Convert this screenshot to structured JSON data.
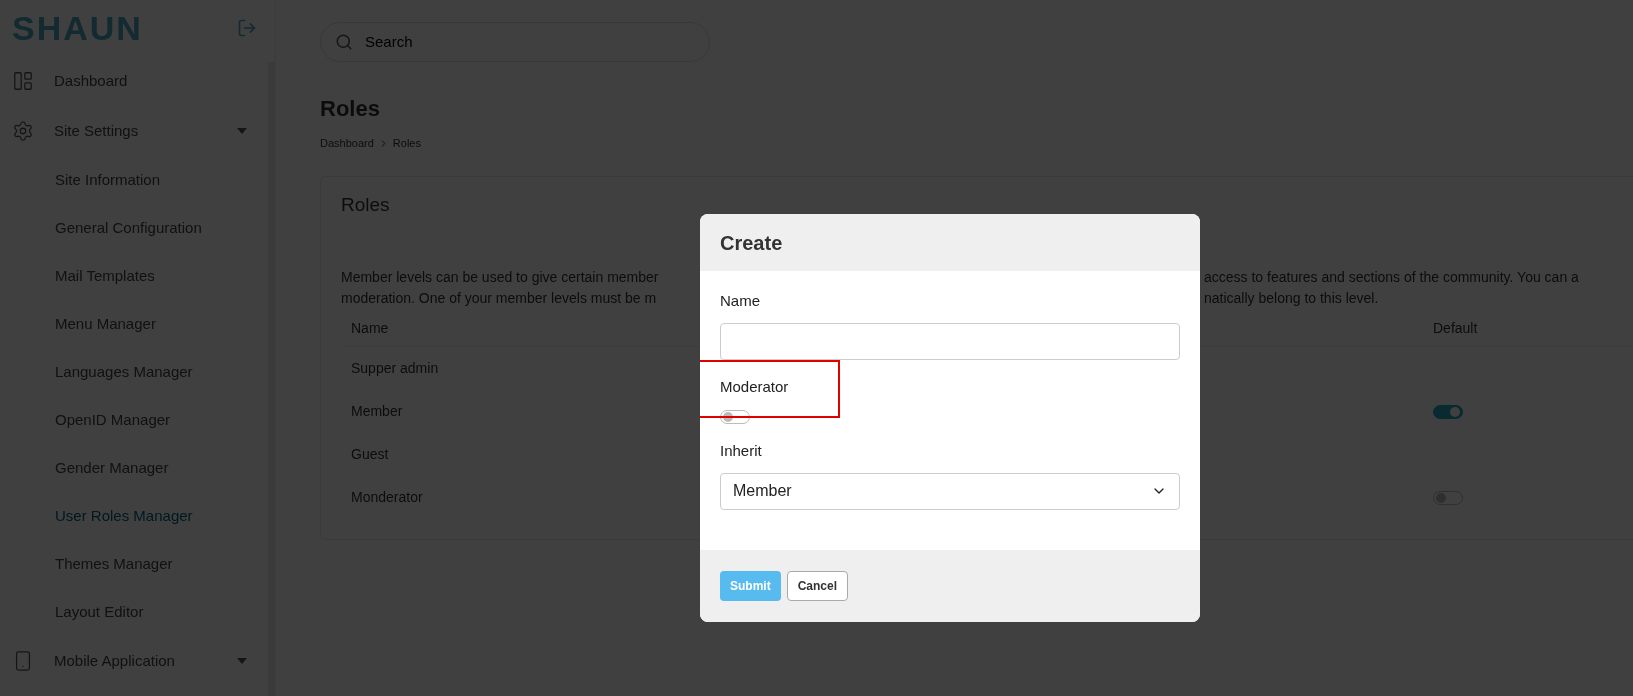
{
  "sidebar": {
    "logo": "SHAUN",
    "items": [
      {
        "kind": "link",
        "label": "Dashboard",
        "selected": false
      },
      {
        "kind": "group",
        "label": "Site Settings",
        "children": [
          {
            "label": "Site Information",
            "selected": false
          },
          {
            "label": "General Configuration",
            "selected": false
          },
          {
            "label": "Mail Templates",
            "selected": false
          },
          {
            "label": "Menu Manager",
            "selected": false
          },
          {
            "label": "Languages Manager",
            "selected": false
          },
          {
            "label": "OpenID Manager",
            "selected": false
          },
          {
            "label": "Gender Manager",
            "selected": false
          },
          {
            "label": "User Roles Manager",
            "selected": true
          },
          {
            "label": "Themes Manager",
            "selected": false
          },
          {
            "label": "Layout Editor",
            "selected": false
          }
        ]
      },
      {
        "kind": "group",
        "label": "Mobile Application"
      }
    ]
  },
  "search": {
    "placeholder": "Search"
  },
  "page_title": "Roles",
  "breadcrumb": [
    "Dashboard",
    "Roles"
  ],
  "card": {
    "title": "Roles",
    "description_left": [
      "Member levels can be used to give certain member",
      "moderation. One of your member levels must be m"
    ],
    "description_right": [
      "access to features and sections of the community. You can a",
      "natically belong to this level."
    ],
    "table": {
      "columns": [
        "Name",
        "Default"
      ],
      "rows": [
        {
          "name": "Supper admin",
          "kind": "plain"
        },
        {
          "name": "Member",
          "kind": "toggle",
          "on": true
        },
        {
          "name": "Guest",
          "kind": "plain"
        },
        {
          "name": "Monderator",
          "kind": "toggle",
          "on": false
        }
      ]
    }
  },
  "modal": {
    "title": "Create",
    "fields": [
      {
        "kind": "text",
        "label": "Name"
      },
      {
        "kind": "switch",
        "label": "Moderator",
        "on": false,
        "highlighted": true
      },
      {
        "kind": "select",
        "label": "Inherit",
        "value": "Member"
      }
    ],
    "buttons": [
      {
        "kind": "primary",
        "label": "Submit"
      },
      {
        "kind": "secondary",
        "label": "Cancel"
      }
    ]
  }
}
